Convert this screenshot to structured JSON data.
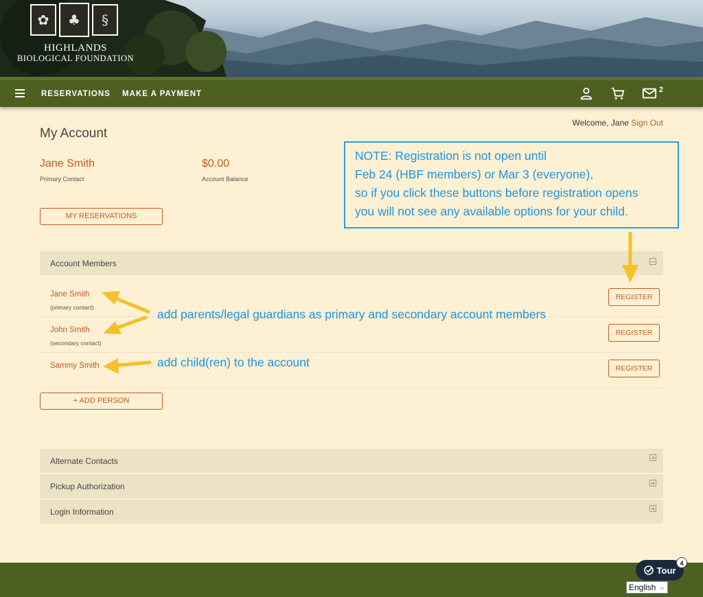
{
  "header": {
    "logo_line1": "HIGHLANDS",
    "logo_line2": "BIOLOGICAL FOUNDATION"
  },
  "nav": {
    "links": [
      "RESERVATIONS",
      "MAKE A PAYMENT"
    ],
    "mail_count": "2",
    "icons": [
      "menu-icon",
      "user-icon",
      "cart-icon",
      "mail-icon"
    ]
  },
  "welcome": {
    "text": "Welcome, Jane",
    "signout": "Sign Out"
  },
  "account": {
    "title": "My Account",
    "contact_name": "Jane Smith",
    "contact_label": "Primary Contact",
    "balance": "$0.00",
    "balance_label": "Account Balance",
    "my_reservations_label": "MY RESERVATIONS",
    "add_person_label": "+ ADD PERSON"
  },
  "note": {
    "lines": [
      "NOTE: Registration is not open until",
      "Feb 24 (HBF members) or Mar 3 (everyone),",
      "so if you click these buttons before registration opens",
      "you will not see any available options for your child."
    ]
  },
  "sections": {
    "members_title": "Account Members",
    "collapsed": [
      "Alternate Contacts",
      "Pickup Authorization",
      "Login Information"
    ]
  },
  "members": [
    {
      "name": "Jane Smith",
      "role": "(primary contact)",
      "button": "REGISTER"
    },
    {
      "name": "John Smith",
      "role": "(secondary contact)",
      "button": "REGISTER"
    },
    {
      "name": "Sammy Smith",
      "role": "",
      "button": "REGISTER"
    }
  ],
  "annotations": {
    "parents": "add parents/legal guardians as primary and secondary account members",
    "children": "add child(ren) to the account"
  },
  "footer": {
    "tour_label": "Tour",
    "tour_badge": "4",
    "language": "English"
  },
  "colors": {
    "accent": "#c15c24",
    "nav_green": "#4d6021",
    "background": "#fdf0d3",
    "annotation_blue": "#1f95dd",
    "arrow_yellow": "#f5c02c"
  }
}
